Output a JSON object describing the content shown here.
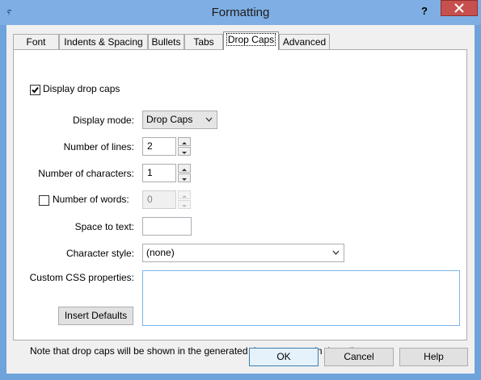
{
  "window": {
    "title": "Formatting",
    "help": "?",
    "app_icon": "ⲋ"
  },
  "tabs": [
    {
      "label": "Font",
      "active": false
    },
    {
      "label": "Indents & Spacing",
      "active": false
    },
    {
      "label": "Bullets",
      "active": false
    },
    {
      "label": "Tabs",
      "active": false
    },
    {
      "label": "Drop Caps",
      "active": true
    },
    {
      "label": "Advanced",
      "active": false
    }
  ],
  "form": {
    "display_drop_caps": {
      "label": "Display drop caps",
      "checked": true
    },
    "display_mode": {
      "label": "Display mode:",
      "value": "Drop Caps"
    },
    "number_of_lines": {
      "label": "Number of lines:",
      "value": "2"
    },
    "number_of_characters": {
      "label": "Number of characters:",
      "value": "1"
    },
    "number_of_words": {
      "label": "Number of words:",
      "value": "0",
      "checked": false,
      "enabled": false
    },
    "space_to_text": {
      "label": "Space to text:",
      "value": ""
    },
    "character_style": {
      "label": "Character style:",
      "value": "(none)"
    },
    "custom_css": {
      "label": "Custom CSS properties:",
      "value": ""
    },
    "insert_defaults": "Insert Defaults",
    "note": "Note that drop caps will be shown in the generated document, not in the editor."
  },
  "buttons": {
    "ok": "OK",
    "cancel": "Cancel",
    "help": "Help"
  },
  "colors": {
    "titlebar": "#7eaee3",
    "close": "#c7504f",
    "default_button_border": "#3c7fb1"
  }
}
